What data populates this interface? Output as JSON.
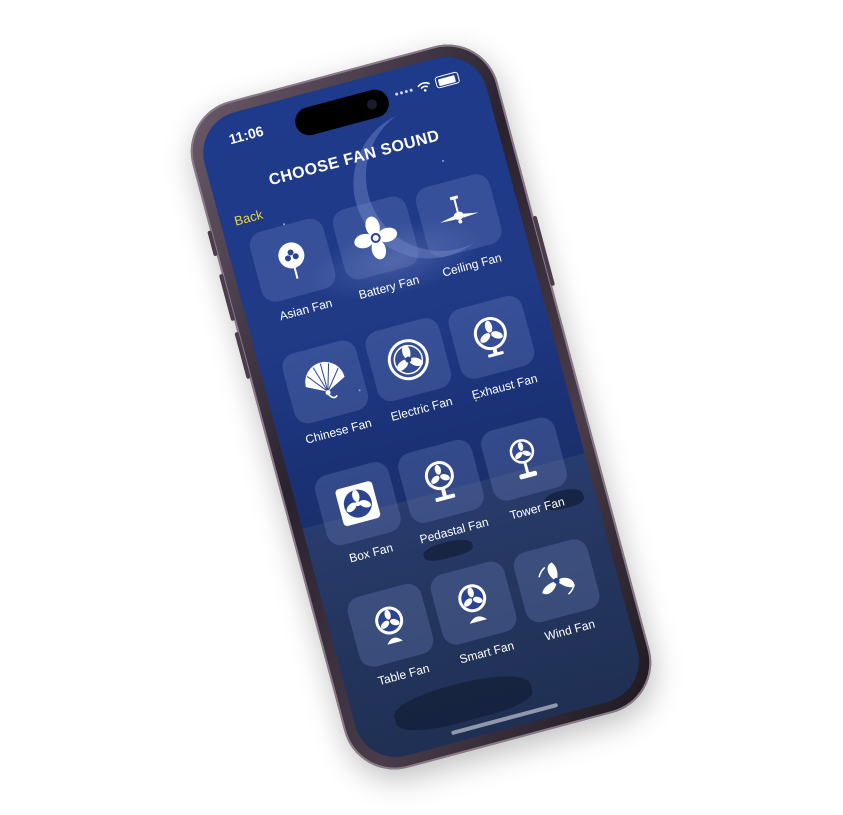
{
  "status": {
    "time": "11:06"
  },
  "header": {
    "title": "CHOOSE FAN SOUND",
    "back_label": "Back"
  },
  "fans": [
    {
      "label": "Asian Fan",
      "icon": "asian-fan-icon"
    },
    {
      "label": "Battery Fan",
      "icon": "battery-fan-icon"
    },
    {
      "label": "Ceiling Fan",
      "icon": "ceiling-fan-icon"
    },
    {
      "label": "Chinese Fan",
      "icon": "chinese-fan-icon"
    },
    {
      "label": "Electric Fan",
      "icon": "electric-fan-icon"
    },
    {
      "label": "Exhaust Fan",
      "icon": "exhaust-fan-icon"
    },
    {
      "label": "Box Fan",
      "icon": "box-fan-icon"
    },
    {
      "label": "Pedastal Fan",
      "icon": "pedastal-fan-icon"
    },
    {
      "label": "Tower Fan",
      "icon": "tower-fan-icon"
    },
    {
      "label": "Table Fan",
      "icon": "table-fan-icon"
    },
    {
      "label": "Smart Fan",
      "icon": "smart-fan-icon"
    },
    {
      "label": "Wind Fan",
      "icon": "wind-fan-icon"
    }
  ],
  "colors": {
    "background": "#1e3a8a",
    "back_link": "#e8d64a",
    "text": "#ffffff"
  }
}
